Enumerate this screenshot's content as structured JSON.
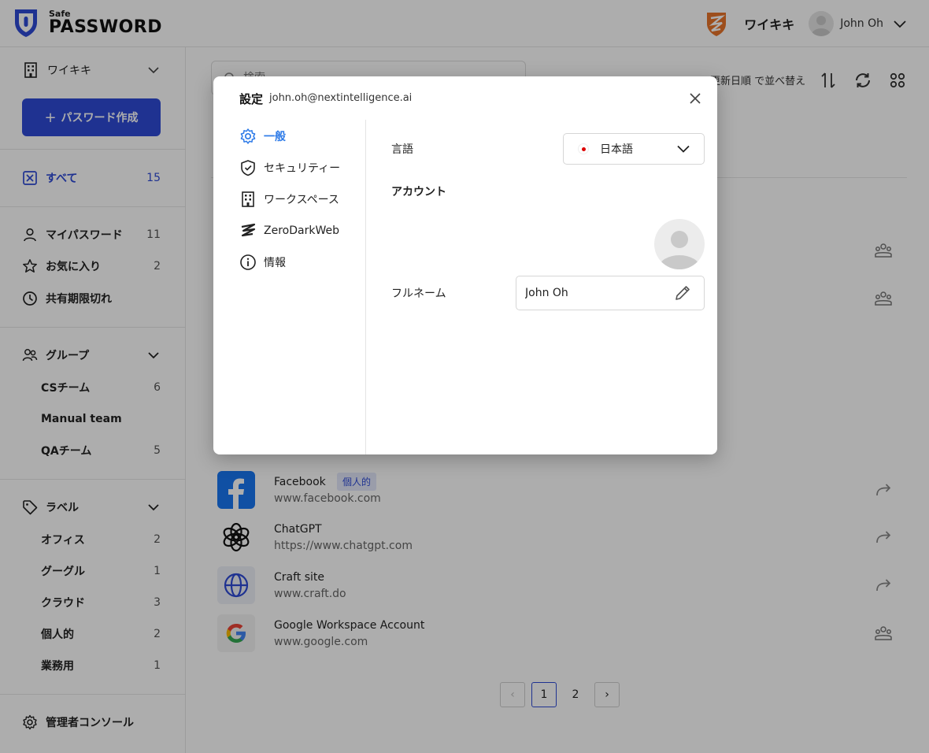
{
  "header": {
    "logo_small": "Safe",
    "logo_big": "PASSWORD",
    "workspace": "ワイキキ",
    "user": "John Oh"
  },
  "sidebar": {
    "workspace": "ワイキキ",
    "create_button": "パスワード作成",
    "all": {
      "label": "すべて",
      "count": "15"
    },
    "items": [
      {
        "label": "マイパスワード",
        "count": "11"
      },
      {
        "label": "お気に入り",
        "count": "2"
      },
      {
        "label": "共有期限切れ",
        "count": ""
      }
    ],
    "groups": {
      "label": "グループ",
      "items": [
        {
          "label": "CSチーム",
          "count": "6"
        },
        {
          "label": "Manual team",
          "count": ""
        },
        {
          "label": "QAチーム",
          "count": "5"
        }
      ]
    },
    "labels": {
      "label": "ラベル",
      "items": [
        {
          "label": "オフィス",
          "count": "2"
        },
        {
          "label": "グーグル",
          "count": "1"
        },
        {
          "label": "クラウド",
          "count": "3"
        },
        {
          "label": "個人的",
          "count": "2"
        },
        {
          "label": "業務用",
          "count": "1"
        }
      ]
    },
    "admin": "管理者コンソール"
  },
  "main": {
    "search_placeholder": "検索",
    "sort_label": "更新日順 で並べ替え",
    "passwords": [
      {
        "name": "Facebook",
        "url": "www.facebook.com",
        "badge": "個人的",
        "action": "share"
      },
      {
        "name": "ChatGPT",
        "url": "https://www.chatgpt.com",
        "badge": "",
        "action": "share"
      },
      {
        "name": "Craft site",
        "url": "www.craft.do",
        "badge": "",
        "action": "share"
      },
      {
        "name": "Google Workspace Account",
        "url": "www.google.com",
        "badge": "",
        "action": "group"
      }
    ],
    "pagination": {
      "prev": "‹",
      "pages": [
        "1",
        "2"
      ],
      "current": "1",
      "next": "›"
    }
  },
  "modal": {
    "title": "設定",
    "email": "john.oh@nextintelligence.ai",
    "nav": [
      {
        "label": "一般",
        "active": true
      },
      {
        "label": "セキュリティー",
        "active": false
      },
      {
        "label": "ワークスペース",
        "active": false
      },
      {
        "label": "ZeroDarkWeb",
        "active": false
      },
      {
        "label": "情報",
        "active": false
      }
    ],
    "language_label": "言語",
    "language_value": "日本語",
    "account_heading": "アカウント",
    "fullname_label": "フルネーム",
    "fullname_value": "John Oh"
  },
  "colors": {
    "accent": "#2e4bd6",
    "link": "#2e7be8",
    "brand_orange": "#e8742a"
  }
}
